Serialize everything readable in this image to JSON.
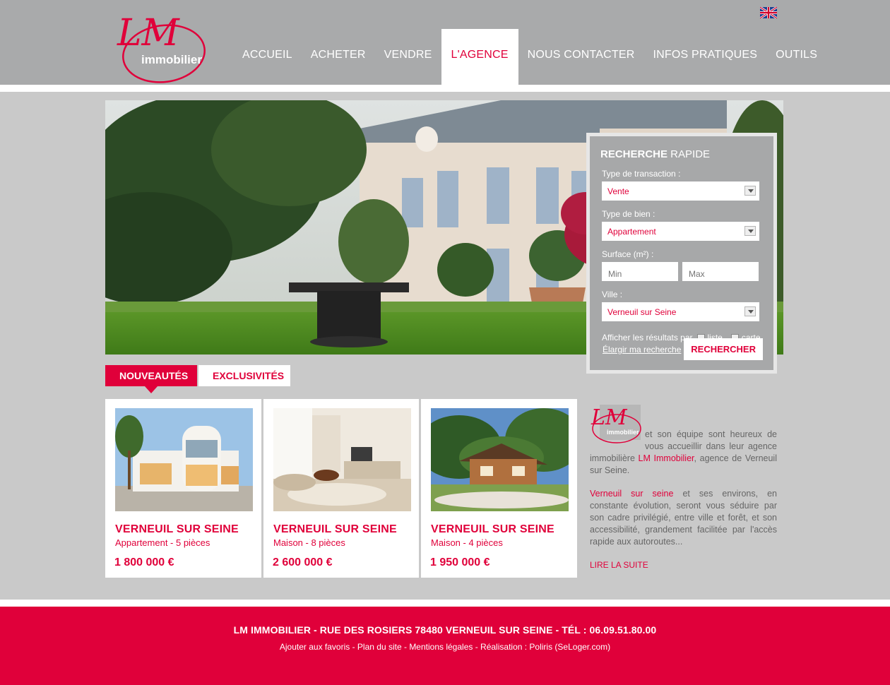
{
  "brand": {
    "logo_text": "LM",
    "logo_sub": "immobilier",
    "accent": "#e0003a"
  },
  "nav": {
    "items": [
      {
        "label": "ACCUEIL"
      },
      {
        "label": "ACHETER"
      },
      {
        "label": "VENDRE"
      },
      {
        "label": "L'AGENCE"
      },
      {
        "label": "NOUS CONTACTER"
      },
      {
        "label": "INFOS PRATIQUES"
      },
      {
        "label": "OUTILS"
      }
    ],
    "active": "L'AGENCE",
    "language_icon": "uk-flag-icon"
  },
  "search": {
    "title_bold": "RECHERCHE",
    "title_light": " RAPIDE",
    "transaction_label": "Type de transaction :",
    "transaction_value": "Vente",
    "property_label": "Type de bien :",
    "property_value": "Appartement",
    "surface_label": "Surface (m²) :",
    "surface_min_placeholder": "Min",
    "surface_max_placeholder": "Max",
    "city_label": "Ville :",
    "city_value": "Verneuil sur Seine",
    "display_label": "Afficher les résultats par",
    "option_list": "liste",
    "option_map": "carte",
    "widen_link": "Élargir ma recherche",
    "submit": "RECHERCHER"
  },
  "tabs": [
    {
      "label": "NOUVEAUTÉS",
      "active": true
    },
    {
      "label": "EXCLUSIVITÉS",
      "active": false
    }
  ],
  "listings": [
    {
      "city": "VERNEUIL SUR SEINE",
      "type": "Appartement - 5 pièces",
      "price": "1 800 000 €",
      "image": "modern-house-photo"
    },
    {
      "city": "VERNEUIL SUR SEINE",
      "type": "Maison - 8 pièces",
      "price": "2 600 000 €",
      "image": "living-room-photo"
    },
    {
      "city": "VERNEUIL SUR SEINE",
      "type": "Maison - 4 pièces",
      "price": "1 950 000 €",
      "image": "chalet-photo"
    }
  ],
  "about": {
    "intro_after_logo": "et son équipe sont heureux de vous accueillir dans leur agence immobilière ",
    "agency_name": "LM Immobilier",
    "intro_end": ", agence de Verneuil sur Seine.",
    "city_link": "Verneuil sur seine",
    "p2": " et ses environs, en constante évolution, seront vous séduire par son cadre privilégié, entre ville et forêt, et son accessibilité, grandement facilitée par l'accès rapide aux autoroutes...",
    "read_more": "LIRE LA SUITE"
  },
  "footer": {
    "address": "LM IMMOBILIER - RUE DES ROSIERS 78480 VERNEUIL SUR SEINE - TÉL : 06.09.51.80.00",
    "links": [
      "Ajouter aux favoris",
      "Plan du site",
      "Mentions légales",
      "Réalisation : Poliris (SeLoger.com)"
    ],
    "separator": " - "
  }
}
